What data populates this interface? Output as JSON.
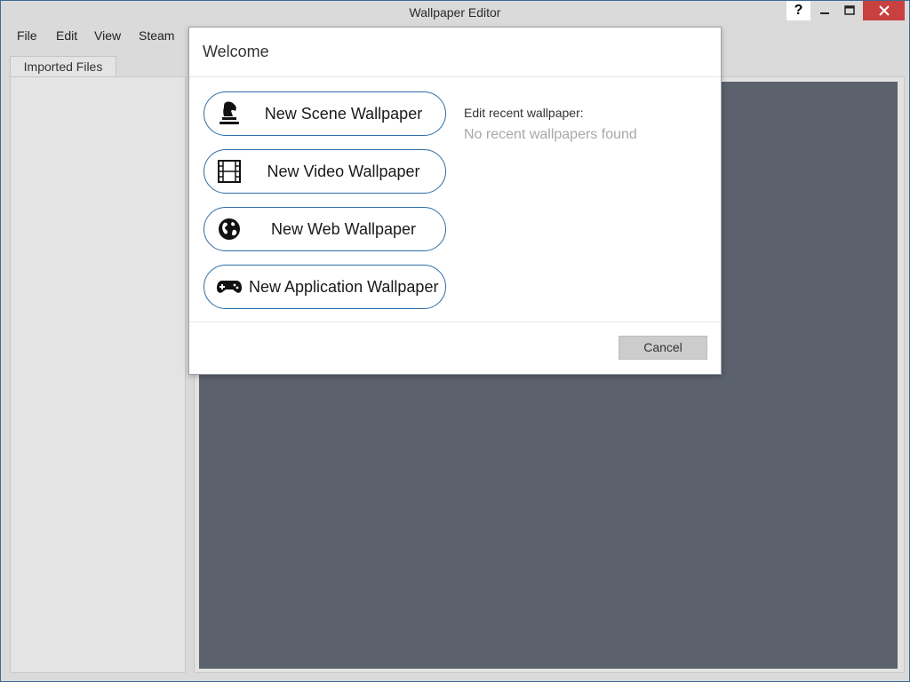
{
  "window": {
    "title": "Wallpaper Editor",
    "help_label": "?",
    "minimize_icon": "minimize-icon",
    "maximize_icon": "maximize-icon",
    "close_icon": "close-icon"
  },
  "menu": [
    "File",
    "Edit",
    "View",
    "Steam"
  ],
  "sidebar": {
    "tab_label": "Imported Files"
  },
  "dialog": {
    "title": "Welcome",
    "buttons": [
      {
        "label": "New Scene Wallpaper",
        "icon": "chess-knight-icon"
      },
      {
        "label": "New Video Wallpaper",
        "icon": "film-strip-icon"
      },
      {
        "label": "New Web Wallpaper",
        "icon": "globe-icon"
      },
      {
        "label": "New Application Wallpaper",
        "icon": "gamepad-icon"
      }
    ],
    "recent_label": "Edit recent wallpaper:",
    "recent_empty": "No recent wallpapers found",
    "cancel_label": "Cancel"
  },
  "colors": {
    "accent_border": "#2e6ea5",
    "close_button": "#c84040",
    "canvas": "#5b626d"
  }
}
